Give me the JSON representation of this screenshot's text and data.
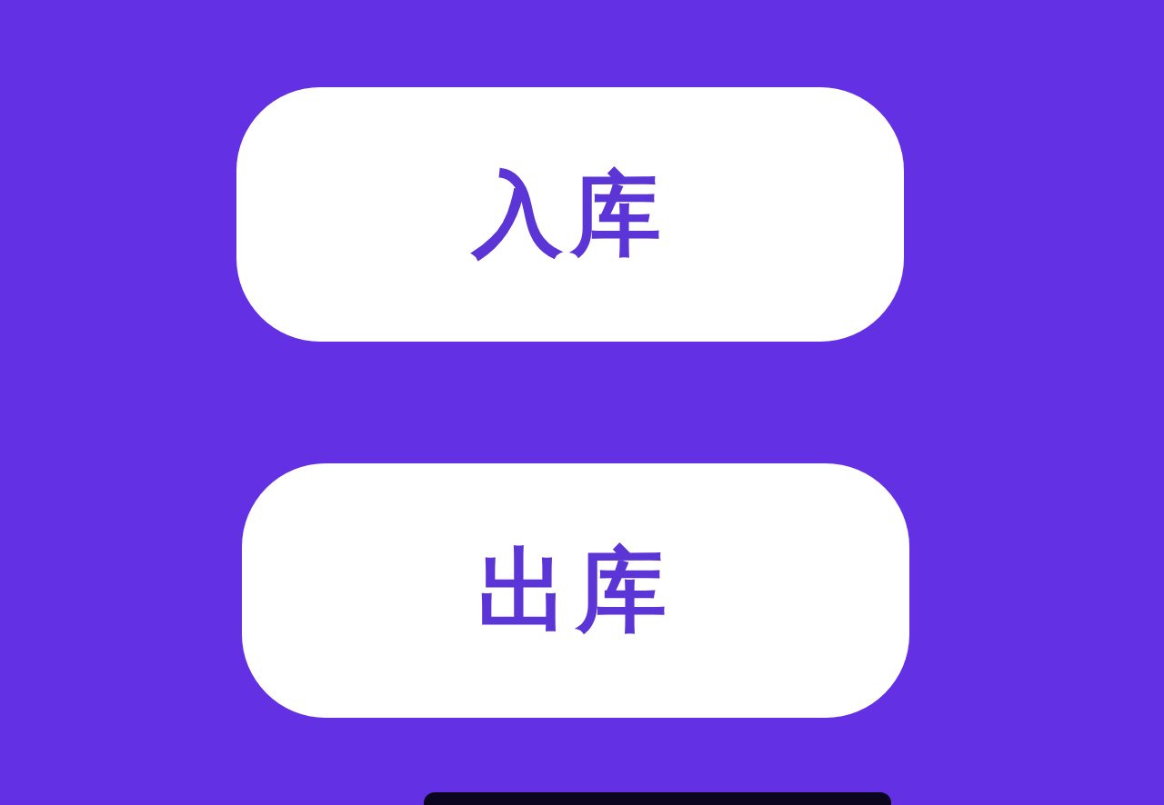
{
  "buttons": [
    {
      "label": "入库"
    },
    {
      "label": "出库"
    }
  ]
}
